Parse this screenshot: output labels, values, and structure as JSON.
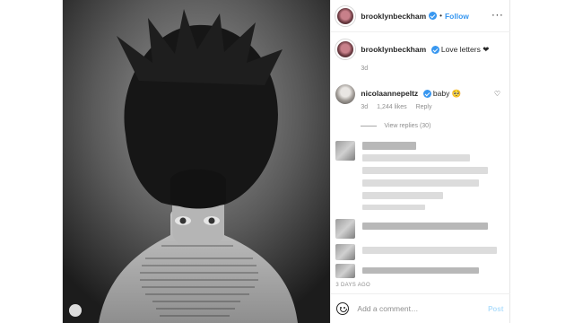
{
  "post": {
    "username": "brooklynbeckham",
    "follow_label": "Follow",
    "dot_separator": "•",
    "more_icon": "more-options-icon",
    "caption": {
      "username": "brooklynbeckham",
      "text": "Love letters ❤",
      "time": "3d"
    },
    "comment": {
      "username": "nicolaannepeltz",
      "text": "baby 🥺",
      "time": "3d",
      "likes": "1,244 likes",
      "reply_label": "Reply",
      "view_replies": "View replies (30)"
    },
    "posted_ago": "3 DAYS AGO",
    "comment_input": {
      "placeholder": "Add a comment…",
      "post_label": "Post"
    }
  },
  "colors": {
    "accent": "#3897f0",
    "muted": "#8e8e8e",
    "text": "#262626"
  },
  "icons": [
    "verified-badge-icon",
    "heart-outline-icon",
    "emoji-icon",
    "camera-icon"
  ]
}
